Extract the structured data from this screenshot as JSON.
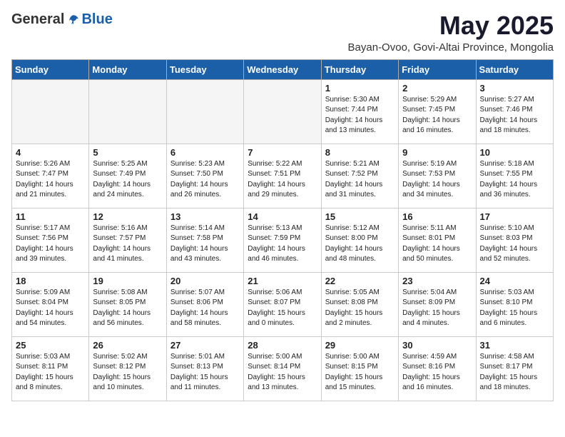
{
  "logo": {
    "general": "General",
    "blue": "Blue"
  },
  "title": "May 2025",
  "subtitle": "Bayan-Ovoo, Govi-Altai Province, Mongolia",
  "headers": [
    "Sunday",
    "Monday",
    "Tuesday",
    "Wednesday",
    "Thursday",
    "Friday",
    "Saturday"
  ],
  "weeks": [
    [
      {
        "day": "",
        "info": ""
      },
      {
        "day": "",
        "info": ""
      },
      {
        "day": "",
        "info": ""
      },
      {
        "day": "",
        "info": ""
      },
      {
        "day": "1",
        "info": "Sunrise: 5:30 AM\nSunset: 7:44 PM\nDaylight: 14 hours\nand 13 minutes."
      },
      {
        "day": "2",
        "info": "Sunrise: 5:29 AM\nSunset: 7:45 PM\nDaylight: 14 hours\nand 16 minutes."
      },
      {
        "day": "3",
        "info": "Sunrise: 5:27 AM\nSunset: 7:46 PM\nDaylight: 14 hours\nand 18 minutes."
      }
    ],
    [
      {
        "day": "4",
        "info": "Sunrise: 5:26 AM\nSunset: 7:47 PM\nDaylight: 14 hours\nand 21 minutes."
      },
      {
        "day": "5",
        "info": "Sunrise: 5:25 AM\nSunset: 7:49 PM\nDaylight: 14 hours\nand 24 minutes."
      },
      {
        "day": "6",
        "info": "Sunrise: 5:23 AM\nSunset: 7:50 PM\nDaylight: 14 hours\nand 26 minutes."
      },
      {
        "day": "7",
        "info": "Sunrise: 5:22 AM\nSunset: 7:51 PM\nDaylight: 14 hours\nand 29 minutes."
      },
      {
        "day": "8",
        "info": "Sunrise: 5:21 AM\nSunset: 7:52 PM\nDaylight: 14 hours\nand 31 minutes."
      },
      {
        "day": "9",
        "info": "Sunrise: 5:19 AM\nSunset: 7:53 PM\nDaylight: 14 hours\nand 34 minutes."
      },
      {
        "day": "10",
        "info": "Sunrise: 5:18 AM\nSunset: 7:55 PM\nDaylight: 14 hours\nand 36 minutes."
      }
    ],
    [
      {
        "day": "11",
        "info": "Sunrise: 5:17 AM\nSunset: 7:56 PM\nDaylight: 14 hours\nand 39 minutes."
      },
      {
        "day": "12",
        "info": "Sunrise: 5:16 AM\nSunset: 7:57 PM\nDaylight: 14 hours\nand 41 minutes."
      },
      {
        "day": "13",
        "info": "Sunrise: 5:14 AM\nSunset: 7:58 PM\nDaylight: 14 hours\nand 43 minutes."
      },
      {
        "day": "14",
        "info": "Sunrise: 5:13 AM\nSunset: 7:59 PM\nDaylight: 14 hours\nand 46 minutes."
      },
      {
        "day": "15",
        "info": "Sunrise: 5:12 AM\nSunset: 8:00 PM\nDaylight: 14 hours\nand 48 minutes."
      },
      {
        "day": "16",
        "info": "Sunrise: 5:11 AM\nSunset: 8:01 PM\nDaylight: 14 hours\nand 50 minutes."
      },
      {
        "day": "17",
        "info": "Sunrise: 5:10 AM\nSunset: 8:03 PM\nDaylight: 14 hours\nand 52 minutes."
      }
    ],
    [
      {
        "day": "18",
        "info": "Sunrise: 5:09 AM\nSunset: 8:04 PM\nDaylight: 14 hours\nand 54 minutes."
      },
      {
        "day": "19",
        "info": "Sunrise: 5:08 AM\nSunset: 8:05 PM\nDaylight: 14 hours\nand 56 minutes."
      },
      {
        "day": "20",
        "info": "Sunrise: 5:07 AM\nSunset: 8:06 PM\nDaylight: 14 hours\nand 58 minutes."
      },
      {
        "day": "21",
        "info": "Sunrise: 5:06 AM\nSunset: 8:07 PM\nDaylight: 15 hours\nand 0 minutes."
      },
      {
        "day": "22",
        "info": "Sunrise: 5:05 AM\nSunset: 8:08 PM\nDaylight: 15 hours\nand 2 minutes."
      },
      {
        "day": "23",
        "info": "Sunrise: 5:04 AM\nSunset: 8:09 PM\nDaylight: 15 hours\nand 4 minutes."
      },
      {
        "day": "24",
        "info": "Sunrise: 5:03 AM\nSunset: 8:10 PM\nDaylight: 15 hours\nand 6 minutes."
      }
    ],
    [
      {
        "day": "25",
        "info": "Sunrise: 5:03 AM\nSunset: 8:11 PM\nDaylight: 15 hours\nand 8 minutes."
      },
      {
        "day": "26",
        "info": "Sunrise: 5:02 AM\nSunset: 8:12 PM\nDaylight: 15 hours\nand 10 minutes."
      },
      {
        "day": "27",
        "info": "Sunrise: 5:01 AM\nSunset: 8:13 PM\nDaylight: 15 hours\nand 11 minutes."
      },
      {
        "day": "28",
        "info": "Sunrise: 5:00 AM\nSunset: 8:14 PM\nDaylight: 15 hours\nand 13 minutes."
      },
      {
        "day": "29",
        "info": "Sunrise: 5:00 AM\nSunset: 8:15 PM\nDaylight: 15 hours\nand 15 minutes."
      },
      {
        "day": "30",
        "info": "Sunrise: 4:59 AM\nSunset: 8:16 PM\nDaylight: 15 hours\nand 16 minutes."
      },
      {
        "day": "31",
        "info": "Sunrise: 4:58 AM\nSunset: 8:17 PM\nDaylight: 15 hours\nand 18 minutes."
      }
    ]
  ]
}
